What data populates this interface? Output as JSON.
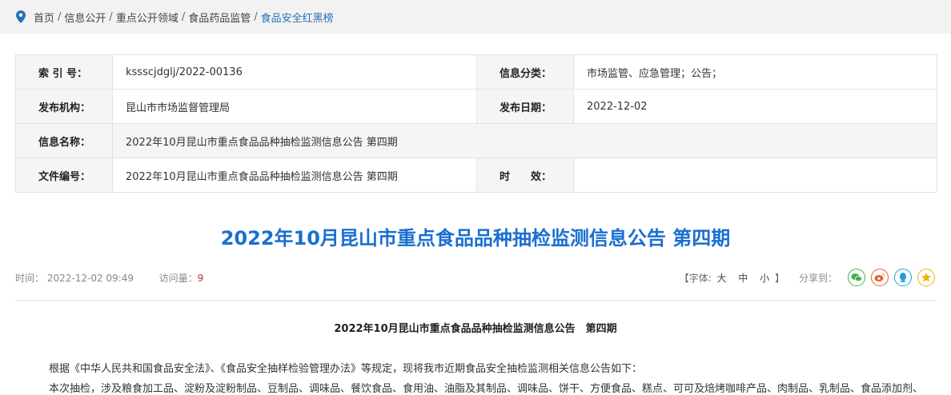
{
  "breadcrumb": {
    "items": [
      "首页",
      "信息公开",
      "重点公开领域",
      "食品药品监管",
      "食品安全红黑榜"
    ],
    "separator": "/"
  },
  "info": {
    "index_label": "索 引 号：",
    "index_value": "ksssсjdglj/2022-00136",
    "category_label": "信息分类：",
    "category_value": "市场监管、应急管理；公告；",
    "org_label": "发布机构：",
    "org_value": "昆山市市场监督管理局",
    "date_label": "发布日期：",
    "date_value": "2022-12-02",
    "name_label": "信息名称：",
    "name_value": "2022年10月昆山市重点食品品种抽检监测信息公告 第四期",
    "doc_label": "文件编号：",
    "doc_value": "2022年10月昆山市重点食品品种抽检监测信息公告 第四期",
    "validity_label": "时　　效：",
    "validity_value": ""
  },
  "article": {
    "title": "2022年10月昆山市重点食品品种抽检监测信息公告 第四期",
    "time_label": "时间：",
    "time_value": "2022-12-02 09:49",
    "visits_label": "访问量：",
    "visits_value": "9",
    "font_open": "【字体:",
    "font_large": "大",
    "font_medium": "中",
    "font_small": "小",
    "font_close": "】",
    "share_label": "分享到：",
    "subtitle": "2022年10月昆山市重点食品品种抽检监测信息公告　第四期",
    "para1": "根据《中华人民共和国食品安全法》、《食品安全抽样检验管理办法》等规定，现将我市近期食品安全抽检监测相关信息公告如下：",
    "para2": "本次抽检，涉及粮食加工品、淀粉及淀粉制品、豆制品、调味品、餐饮食品、食用油、油脂及其制品、调味品、饼干、方便食品、糕点、可可及焙烤咖啡产品、肉制品、乳制品、食品添加剂、"
  },
  "colors": {
    "accent": "#1a6fd0",
    "breadcrumb_current": "#2a6fb8",
    "wechat": "#3cb34a",
    "weibo": "#e6612c",
    "qq": "#1e9fe0",
    "qzone": "#f2b200"
  },
  "icons": [
    "location-pin-icon",
    "wechat-icon",
    "weibo-icon",
    "qq-icon",
    "qzone-icon"
  ]
}
